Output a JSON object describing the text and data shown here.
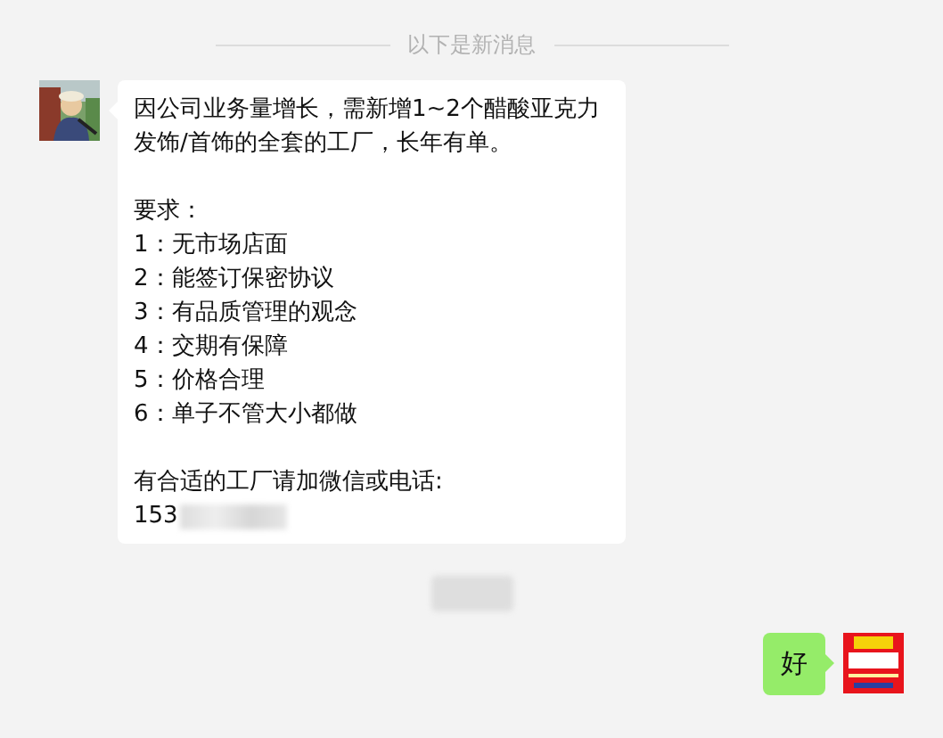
{
  "divider": {
    "label": "以下是新消息"
  },
  "messages": [
    {
      "kind": "received",
      "paragraphs": [
        [
          "因公司业务量增长，需新增1~2个醋酸亚克力发饰/首饰的全套的工厂，长年有单。"
        ],
        [
          "要求：",
          "1：无市场店面",
          "2：能签订保密协议",
          "3：有品质管理的观念",
          "4：交期有保障",
          "5：价格合理",
          "6：单子不管大小都做"
        ],
        [
          "有合适的工厂请加微信或电话:",
          "153"
        ]
      ],
      "redacted_tail": true
    },
    {
      "kind": "timestamp",
      "redacted_tail": true
    },
    {
      "kind": "sent",
      "paragraphs": [
        [
          "好"
        ]
      ]
    }
  ]
}
